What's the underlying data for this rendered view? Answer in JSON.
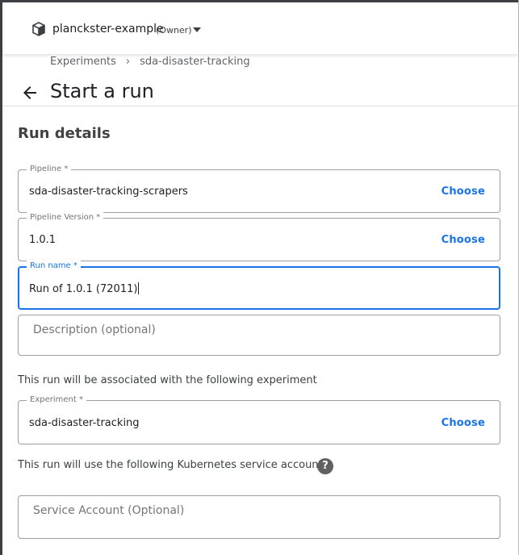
{
  "namespace": {
    "name": "planckster-example",
    "role": "(Owner)"
  },
  "breadcrumb": {
    "items": [
      "Experiments",
      "sda-disaster-tracking"
    ],
    "separator": "›"
  },
  "page": {
    "title": "Start a run"
  },
  "run_details": {
    "section_title": "Run details",
    "pipeline": {
      "label": "Pipeline *",
      "value": "sda-disaster-tracking-scrapers",
      "action": "Choose"
    },
    "pipeline_version": {
      "label": "Pipeline Version *",
      "value": "1.0.1",
      "action": "Choose"
    },
    "run_name": {
      "label": "Run name *",
      "value": "Run of 1.0.1 (72011)"
    },
    "description": {
      "placeholder": "Description (optional)"
    },
    "experiment_info": "This run will be associated with the following experiment",
    "experiment": {
      "label": "Experiment *",
      "value": "sda-disaster-tracking",
      "action": "Choose"
    },
    "service_account_info": "This run will use the following Kubernetes service account.",
    "service_account": {
      "placeholder": "Service Account (Optional)"
    }
  },
  "colors": {
    "accent": "#1a73e8",
    "border": "#9e9e9e",
    "help_icon": "#616161"
  },
  "icons": {
    "namespace": "cube-icon",
    "dropdown": "caret-down-icon",
    "back": "arrow-back-icon",
    "help": "help-circle-icon"
  }
}
